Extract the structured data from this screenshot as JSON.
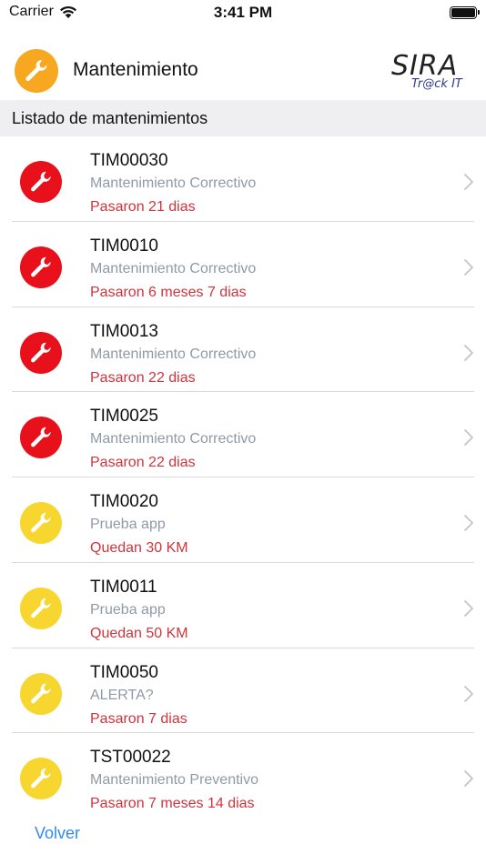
{
  "status_bar": {
    "carrier": "Carrier",
    "time": "3:41 PM"
  },
  "header": {
    "title": "Mantenimiento",
    "icon": "wrench-icon"
  },
  "logo": {
    "text_main": "SIRA",
    "text_sub": "Tr@ck IT"
  },
  "section": {
    "title": "Listado de mantenimientos"
  },
  "colors": {
    "red": "#e8101a",
    "yellow": "#f8d630",
    "orange": "#f7a820",
    "status_text": "#d0343d",
    "link": "#2f8bf0"
  },
  "items": [
    {
      "code": "TIM00030",
      "type": "Mantenimiento Correctivo",
      "status": "Pasaron 21 dias",
      "severity": "red"
    },
    {
      "code": "TIM0010",
      "type": "Mantenimiento Correctivo",
      "status": "Pasaron 6 meses 7 dias",
      "severity": "red"
    },
    {
      "code": "TIM0013",
      "type": "Mantenimiento Correctivo",
      "status": "Pasaron 22 dias",
      "severity": "red"
    },
    {
      "code": "TIM0025",
      "type": "Mantenimiento Correctivo",
      "status": "Pasaron 22 dias",
      "severity": "red"
    },
    {
      "code": "TIM0020",
      "type": "Prueba app",
      "status": "Quedan 30 KM",
      "severity": "yellow"
    },
    {
      "code": "TIM0011",
      "type": "Prueba app",
      "status": "Quedan 50 KM",
      "severity": "yellow"
    },
    {
      "code": "TIM0050",
      "type": "ALERTA?",
      "status": "Pasaron 7 dias",
      "severity": "yellow"
    },
    {
      "code": "TST00022",
      "type": "Mantenimiento Preventivo",
      "status": "Pasaron 7 meses 14 dias",
      "severity": "yellow"
    }
  ],
  "footer": {
    "back_label": "Volver"
  }
}
